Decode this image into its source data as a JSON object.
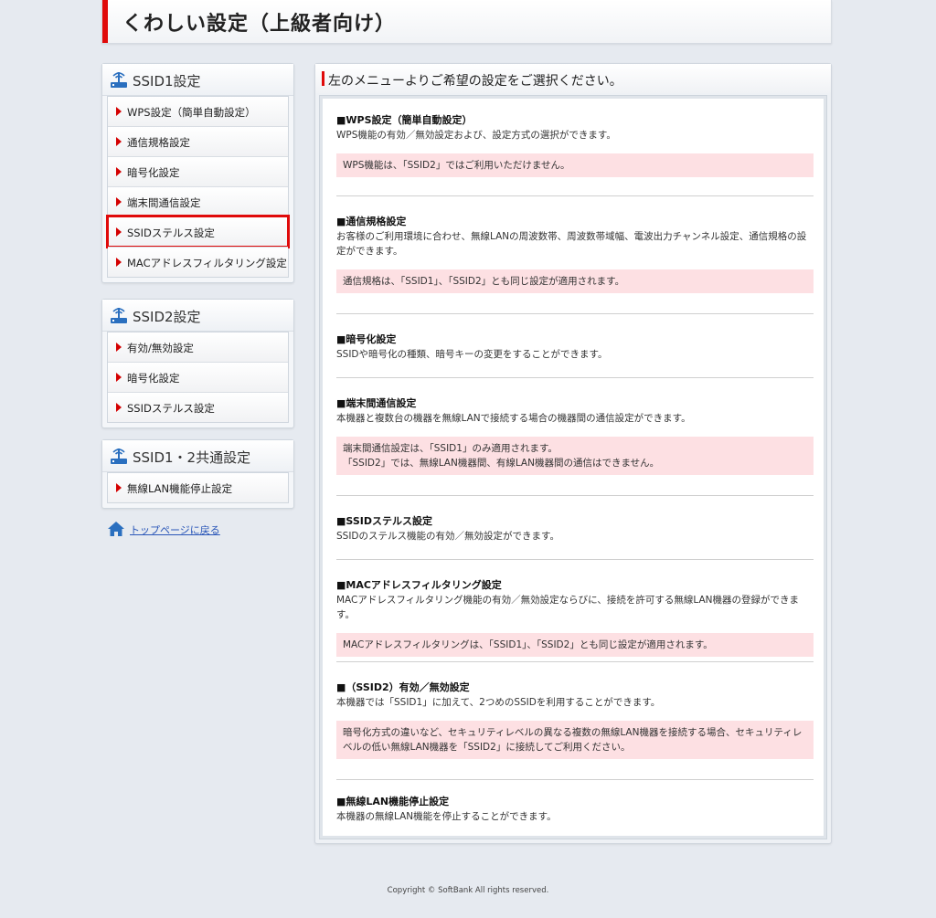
{
  "header": {
    "title": "くわしい設定（上級者向け）"
  },
  "sidebar": {
    "ssid1": {
      "title": "SSID1設定",
      "items": [
        {
          "label": "WPS設定（簡単自動設定）"
        },
        {
          "label": "通信規格設定"
        },
        {
          "label": "暗号化設定"
        },
        {
          "label": "端末間通信設定"
        },
        {
          "label": "SSIDステルス設定",
          "selected": true
        },
        {
          "label": "MACアドレスフィルタリング設定"
        }
      ]
    },
    "ssid2": {
      "title": "SSID2設定",
      "items": [
        {
          "label": "有効/無効設定"
        },
        {
          "label": "暗号化設定"
        },
        {
          "label": "SSIDステルス設定"
        }
      ]
    },
    "common": {
      "title": "SSID1・2共通設定",
      "items": [
        {
          "label": "無線LAN機能停止設定"
        }
      ]
    },
    "top_link": "トップページに戻る"
  },
  "main": {
    "heading": "左のメニューよりご希望の設定をご選択ください。",
    "sections": [
      {
        "title": "■WPS設定（簡単自動設定）",
        "desc": "WPS機能の有効／無効設定および、設定方式の選択ができます。",
        "note": "WPS機能は、「SSID2」ではご利用いただけません。"
      },
      {
        "title": "■通信規格設定",
        "desc": "お客様のご利用環境に合わせ、無線LANの周波数帯、周波数帯域幅、電波出力チャンネル設定、通信規格の設定ができます。",
        "note": "通信規格は、「SSID1」、「SSID2」とも同じ設定が適用されます。"
      },
      {
        "title": "■暗号化設定",
        "desc": "SSIDや暗号化の種類、暗号キーの変更をすることができます。"
      },
      {
        "title": "■端末間通信設定",
        "desc": "本機器と複数台の機器を無線LANで接続する場合の機器間の通信設定ができます。",
        "note": "端末間通信設定は、「SSID1」のみ適用されます。\n「SSID2」では、無線LAN機器間、有線LAN機器間の通信はできません。"
      },
      {
        "title": "■SSIDステルス設定",
        "desc": "SSIDのステルス機能の有効／無効設定ができます。"
      },
      {
        "title": "■MACアドレスフィルタリング設定",
        "desc": "MACアドレスフィルタリング機能の有効／無効設定ならびに、接続を許可する無線LAN機器の登録ができます。",
        "note": "MACアドレスフィルタリングは、「SSID1」、「SSID2」とも同じ設定が適用されます。"
      },
      {
        "title": "■（SSID2）有効／無効設定",
        "desc": "本機器では「SSID1」に加えて、2つめのSSIDを利用することができます。",
        "note": "暗号化方式の違いなど、セキュリティレベルの異なる複数の無線LAN機器を接続する場合、セキュリティレベルの低い無線LAN機器を「SSID2」に接続してご利用ください。"
      },
      {
        "title": "■無線LAN機能停止設定",
        "desc": "本機器の無線LAN機能を停止することができます。"
      }
    ]
  },
  "footer": {
    "copyright": "Copyright © SoftBank All rights reserved."
  },
  "colors": {
    "accent_red": "#e00a0a",
    "note_bg": "#fde0e3",
    "link_blue": "#2a56b8"
  }
}
